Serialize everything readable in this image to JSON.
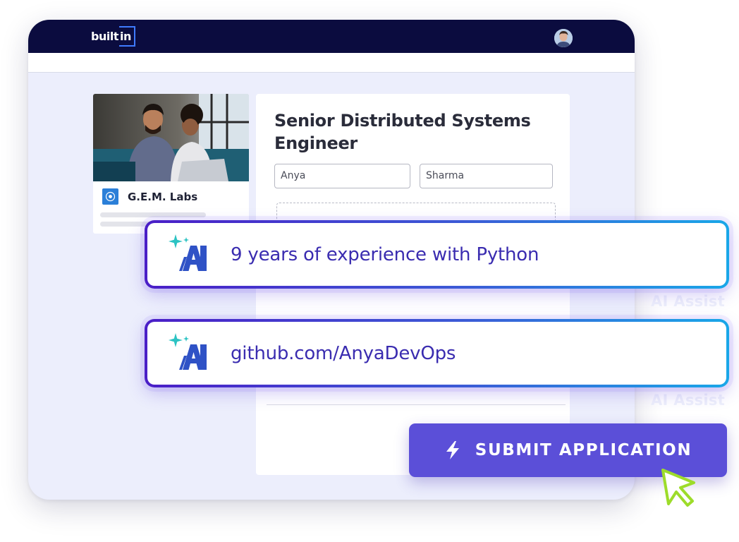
{
  "header": {
    "logo_text": "built",
    "logo_box_text": "in",
    "avatar_icon": "user-avatar"
  },
  "company": {
    "name": "G.E.M. Labs",
    "logo_icon": "company-logo-icon"
  },
  "job": {
    "title": "Senior Distributed Systems Engineer"
  },
  "form": {
    "first_name": "Anya",
    "last_name": "Sharma"
  },
  "ai_suggestions": [
    {
      "text": "9 years of experience with Python",
      "icon": "ai-sparkle-icon"
    },
    {
      "text": "github.com/AnyaDevOps",
      "icon": "ai-sparkle-icon"
    }
  ],
  "ghost_labels": [
    "AI Assist",
    "AI Assist"
  ],
  "submit": {
    "label": "SUBMIT APPLICATION",
    "icon": "lightning-bolt-icon"
  },
  "colors": {
    "nav_bg": "#0b0c3f",
    "page_bg": "#eceefc",
    "accent": "#5b4fd8",
    "ai_gradient_start": "#4a1ec7",
    "ai_gradient_end": "#19a7e8",
    "ai_text": "#3a2cb0"
  }
}
